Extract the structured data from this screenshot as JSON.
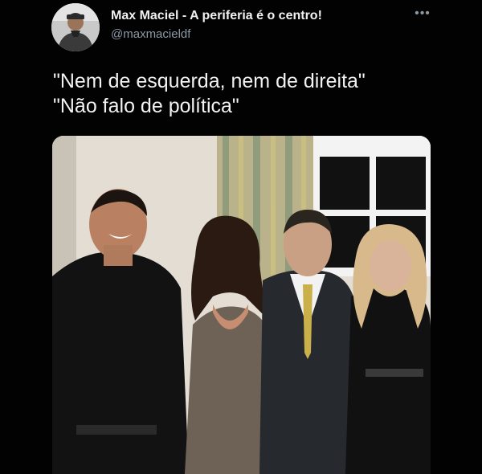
{
  "tweet": {
    "author": {
      "display_name": "Max Maciel - A periferia é o centro!",
      "handle": "@maxmacieldf",
      "avatar_icon": "user-avatar"
    },
    "more_icon": "more-horizontal-icon",
    "more_label": "•••",
    "text_lines": [
      "\"Nem de esquerda, nem de direita\"",
      "\"Não falo de política\""
    ],
    "media": {
      "description_icon": "photo"
    }
  },
  "colors": {
    "background": "#020202",
    "text": "#f2f2f2",
    "secondary_text": "#8b98a5"
  }
}
